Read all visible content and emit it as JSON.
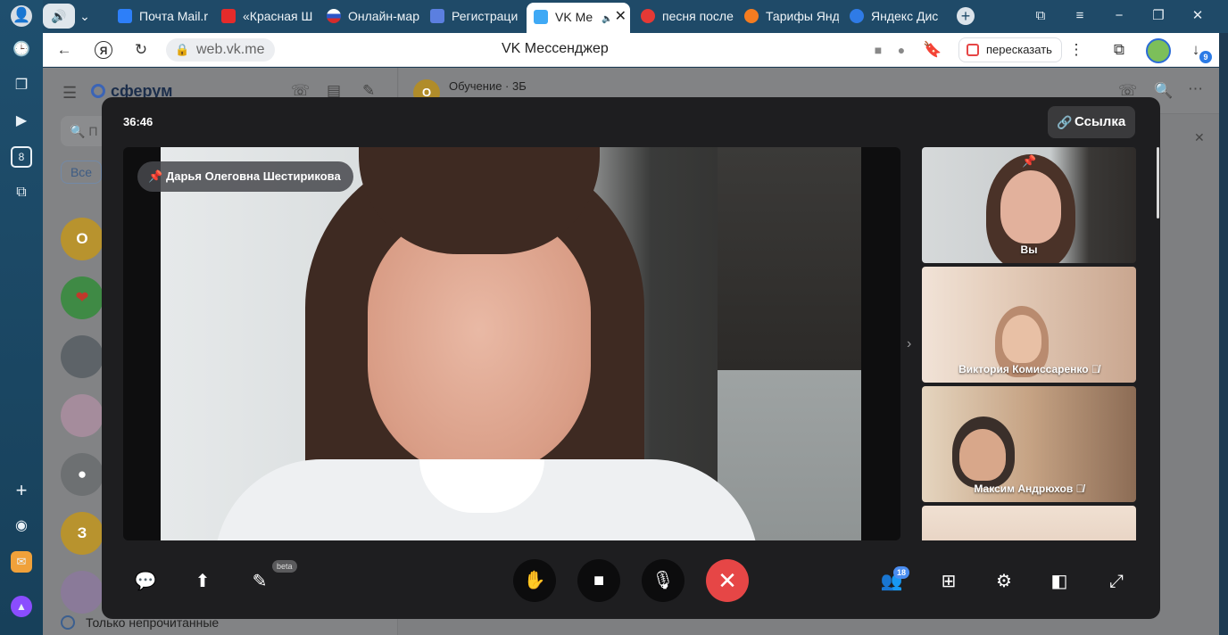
{
  "browser": {
    "tabs": [
      {
        "label": "Почта Mail.r",
        "color": "#2d7ff9"
      },
      {
        "label": "«Красная Ш",
        "color": "#e52b2b"
      },
      {
        "label": "Онлайн-мар",
        "color": "#d9dde8"
      },
      {
        "label": "Регистраци",
        "color": "#5b7fe0"
      },
      {
        "label": "VK Ме",
        "color": "#3fa9f5"
      },
      {
        "label": "песня после",
        "color": "#e53935"
      },
      {
        "label": "Тарифы Янд",
        "color": "#f47c20"
      },
      {
        "label": "Яндекс Дис",
        "color": "#2f7be6"
      }
    ],
    "url": "web.vk.me",
    "page_title": "VK Мессенджер",
    "retell_label": "пересказать",
    "downloads_count": "9",
    "sidebar_number": "8"
  },
  "vk": {
    "brand": "сферум",
    "search_placeholder": "П",
    "filter_all": "Все",
    "channel_avatar": "О",
    "channel_title": "Обучение · 3Б",
    "chat_avatars": [
      {
        "letter": "О",
        "color": "#b8932e"
      },
      {
        "letter": "",
        "color": "#3f8a45"
      },
      {
        "letter": "",
        "color": "#5d6368"
      },
      {
        "letter": "",
        "color": "#a58c9c"
      },
      {
        "letter": "",
        "color": "#6d7072"
      },
      {
        "letter": "З",
        "color": "#b8932e"
      },
      {
        "letter": "",
        "color": "#8a7a99"
      }
    ],
    "unread_only": "Только непрочитанные"
  },
  "call": {
    "timer": "36:46",
    "link_label": "Ссылка",
    "pinned_name": "Дарья Олеговна Шестирикова",
    "participants": [
      {
        "name": "Вы",
        "pinned": true
      },
      {
        "name": "Виктория Комиссаренко",
        "muted": true
      },
      {
        "name": "Максим Андрюхов",
        "muted": true
      },
      {
        "name": ""
      }
    ],
    "beta_label": "beta",
    "participants_count": "18"
  }
}
